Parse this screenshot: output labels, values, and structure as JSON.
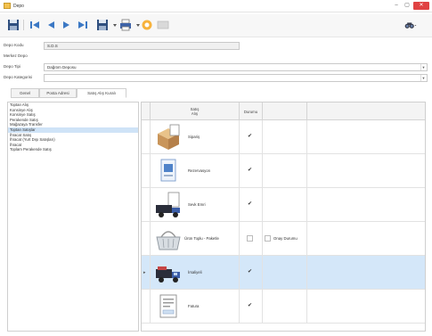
{
  "window": {
    "title": "Depo",
    "minimize": "–",
    "maximize": "▢",
    "close": "✕"
  },
  "toolbar": {
    "icons": [
      "save-icon",
      "first-icon",
      "previous-icon",
      "next-icon",
      "last-icon",
      "save-as-icon",
      "print-icon",
      "find-icon",
      "disabled-icon",
      "binoculars-icon"
    ]
  },
  "form": {
    "depo_kodu_label": "Depo Kodu",
    "depo_kodu_value": "S.D.S",
    "merkez_depo_label": "Merkez Depo",
    "depo_tipi_label": "Depo Tipi",
    "depo_tipi_value": "Dağıtım Deposu",
    "depo_kategorisi_label": "Depo Kategorisi",
    "depo_kategorisi_value": ""
  },
  "tabs": [
    {
      "label": "Genel"
    },
    {
      "label": "Posta Adresi"
    },
    {
      "label": "Satış Alış Kuralı"
    }
  ],
  "left_list": [
    "Toptan Alış",
    "Konsinye Alış",
    "Konsinye Satış",
    "Perakende Satış",
    "Mağazaya Transfer",
    "Toptan Satışlar",
    "İhracat Satış",
    "İhracat (Yurt Dışı Satışları)",
    "İhracat",
    "Toplam Perakende Satış"
  ],
  "grid": {
    "headers": [
      "Satış\nAlış",
      "Durumu"
    ],
    "rows": [
      {
        "label": "Sipariş",
        "checked": true,
        "extra": null
      },
      {
        "label": "Rezervasyon",
        "checked": true,
        "extra": null
      },
      {
        "label": "Sevk Emri",
        "checked": true,
        "extra": null
      },
      {
        "label": "Ürün Toplu - Paketle",
        "checked": false,
        "extra": "Onay Durumu"
      },
      {
        "label": "İrsaliyeli",
        "checked": true,
        "extra": null
      },
      {
        "label": "Fatura",
        "checked": true,
        "extra": null
      }
    ]
  },
  "colors": {
    "selection": "#d4e7f9",
    "close_button": "#e04343"
  }
}
